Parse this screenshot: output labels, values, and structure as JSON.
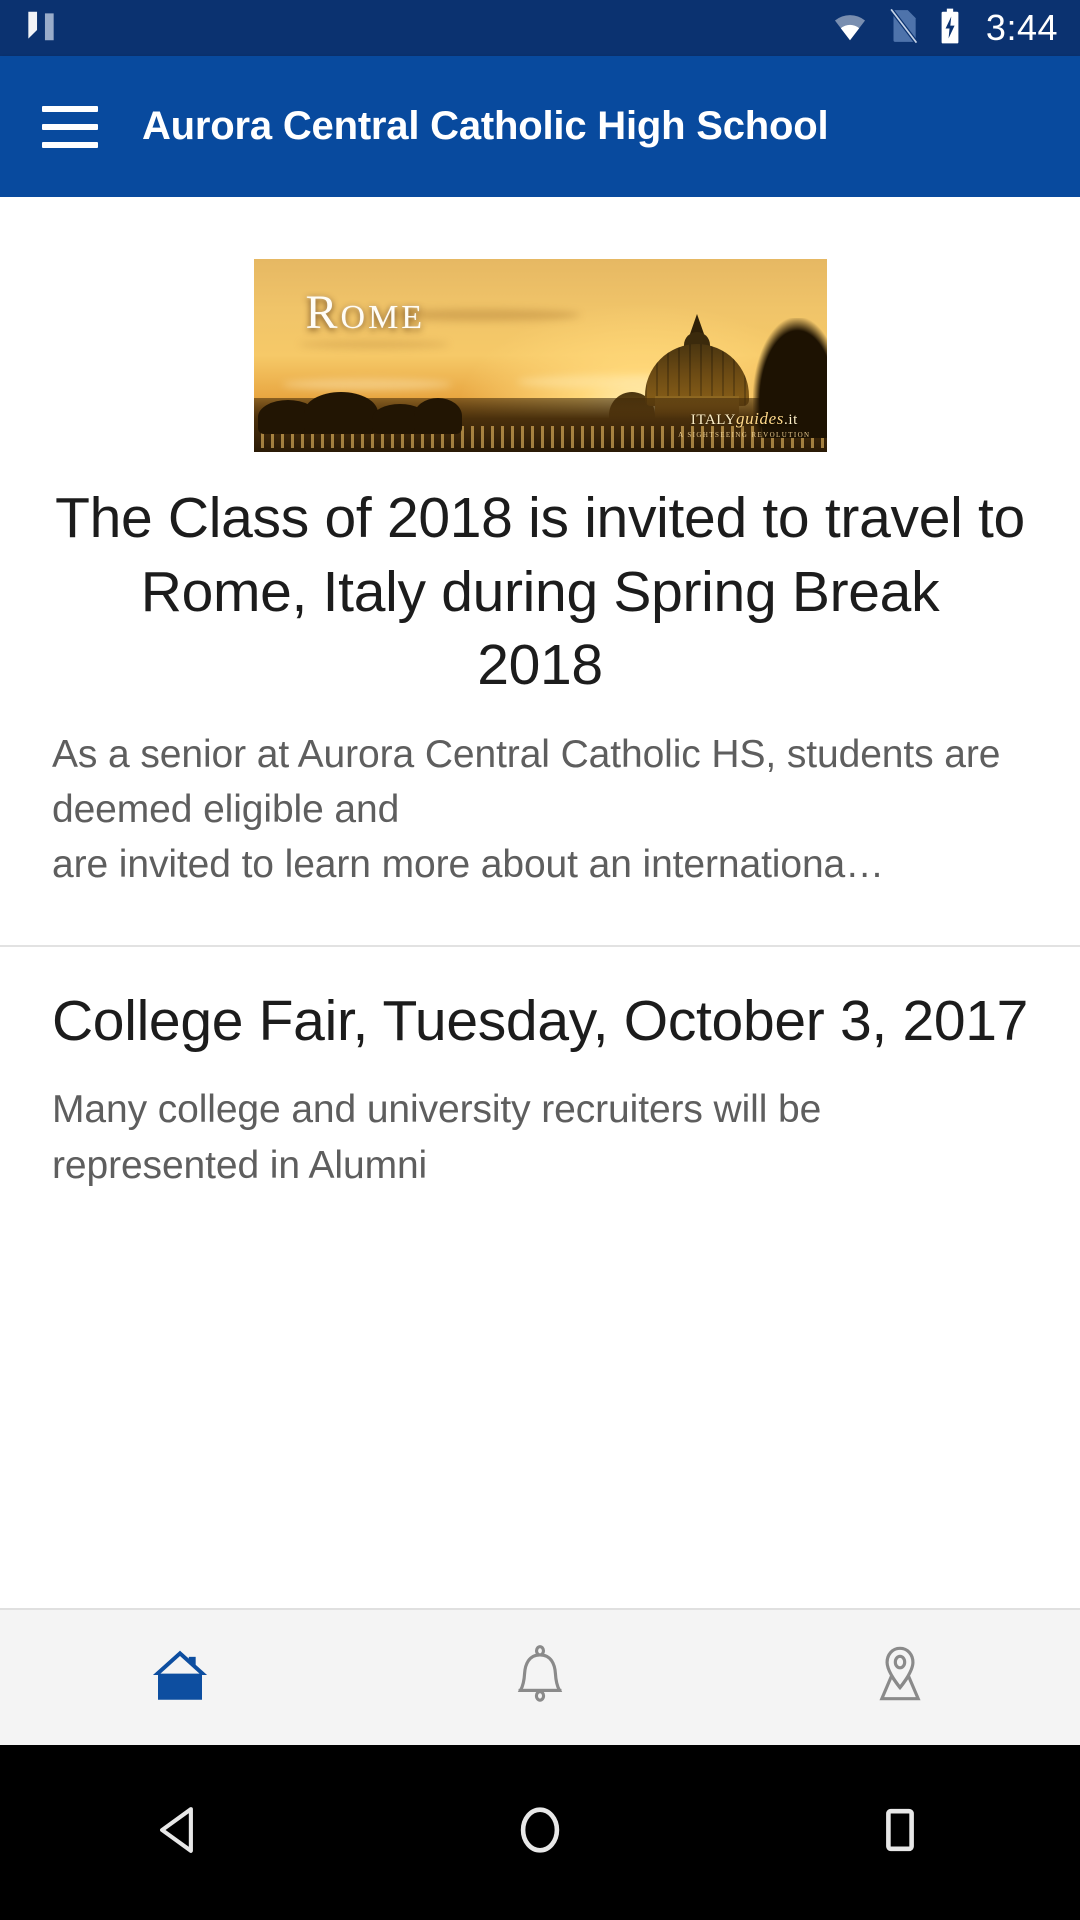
{
  "status_bar": {
    "time": "3:44",
    "icons": [
      "android-n-logo",
      "wifi-icon",
      "no-sim-icon",
      "battery-charging-icon"
    ],
    "background": "#0b3270"
  },
  "app_bar": {
    "menu_icon": "hamburger-menu-icon",
    "title": "Aurora Central Catholic High School",
    "background": "#084a9e",
    "text_color": "#ffffff"
  },
  "feed": {
    "items": [
      {
        "banner": {
          "title": "Rome",
          "watermark_brand": "ITALYguides.it",
          "watermark_tagline": "A SIGHTSEEING REVOLUTION",
          "alt": "Rome skyline at sunset with St Peter's Basilica dome"
        },
        "headline": "The Class of 2018 is invited to travel to Rome, Italy during Spring Break\n2018",
        "body": "As a senior at Aurora Central Catholic HS, students are deemed eligible and\nare invited to learn more about an internationa…"
      },
      {
        "headline": "College Fair, Tuesday, October 3, 2017",
        "body": "Many college and university recruiters will be represented in Alumni"
      }
    ]
  },
  "tab_bar": {
    "background": "#f4f4f4",
    "active_color": "#0d4ea0",
    "inactive_color": "#8a8a8a",
    "tabs": [
      {
        "icon": "home-icon",
        "label": "Home",
        "active": true
      },
      {
        "icon": "bell-icon",
        "label": "Notifications",
        "active": false
      },
      {
        "icon": "map-pin-icon",
        "label": "Map",
        "active": false
      }
    ]
  },
  "nav_bar": {
    "background": "#000000",
    "buttons": [
      {
        "icon": "back-triangle-icon",
        "label": "Back"
      },
      {
        "icon": "home-circle-icon",
        "label": "Home"
      },
      {
        "icon": "recents-square-icon",
        "label": "Recents"
      }
    ]
  }
}
